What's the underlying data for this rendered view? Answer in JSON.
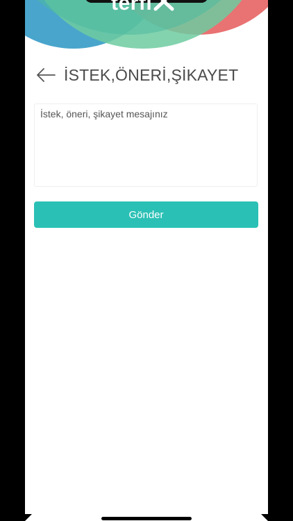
{
  "app": {
    "logo_text": "terfi",
    "brand_colors": {
      "teal": "#2bc0b5",
      "blue": "#3fa0c9",
      "green": "#6dcba0",
      "red": "#e86a6a"
    }
  },
  "header": {
    "back_icon": "arrow-left-icon",
    "title": "İSTEK,ÖNERİ,ŞİKAYET"
  },
  "form": {
    "message_placeholder": "İstek, öneri, şikayet mesajınız",
    "message_value": "",
    "submit_label": "Gönder"
  }
}
